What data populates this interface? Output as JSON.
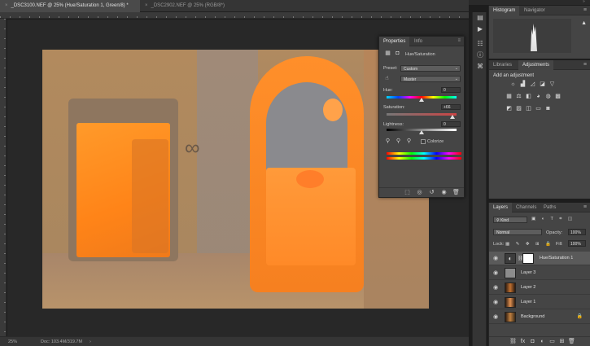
{
  "tabs": [
    {
      "label": "_DSC3100.NEF @ 25% (Hue/Saturation 1, Green/8) *",
      "active": true
    },
    {
      "label": "_DSC2902.NEF @ 25% (RGB/8*)",
      "active": false
    }
  ],
  "status": {
    "zoom": "25%",
    "doc": "Doc: 103.4M/319.7M"
  },
  "properties": {
    "tabs": [
      "Properties",
      "Info"
    ],
    "title": "Hue/Saturation",
    "preset_label": "Preset:",
    "preset_value": "Custom",
    "channel_value": "Master",
    "hue_label": "Hue:",
    "hue_value": "0",
    "saturation_label": "Saturation:",
    "saturation_value": "+66",
    "lightness_label": "Lightness:",
    "lightness_value": "0",
    "colorize_label": "Colorize"
  },
  "histogram": {
    "tabs": [
      "Histogram",
      "Navigator"
    ]
  },
  "adjustments": {
    "tabs": [
      "Libraries",
      "Adjustments"
    ],
    "title": "Add an adjustment"
  },
  "layers": {
    "tabs": [
      "Layers",
      "Channels",
      "Paths"
    ],
    "kind_label": "Kind",
    "blend_mode": "Normal",
    "opacity_label": "Opacity:",
    "opacity_value": "100%",
    "lock_label": "Lock:",
    "fill_label": "Fill:",
    "fill_value": "100%",
    "items": [
      {
        "name": "Hue/Saturation 1",
        "selected": true
      },
      {
        "name": "Layer 3",
        "selected": false
      },
      {
        "name": "Layer 2",
        "selected": false
      },
      {
        "name": "Layer 1",
        "selected": false
      },
      {
        "name": "Background",
        "selected": false
      }
    ]
  },
  "colors": {
    "photo_orange": "#ff8a1e",
    "photo_mauve": "#a48a74",
    "panel_bg": "#454545"
  },
  "icons": [
    "close-icon",
    "collapse-icon",
    "panel-menu-icon",
    "eye-icon",
    "lock-icon",
    "eyedropper-icon",
    "hand-icon",
    "warning-icon",
    "trash-icon",
    "visibility-icon",
    "reset-icon",
    "clip-icon",
    "link-icon",
    "new-layer-icon",
    "fx-icon",
    "mask-icon",
    "folder-icon",
    "adjustment-icon",
    "brightness-icon",
    "levels-icon",
    "curves-icon",
    "exposure-icon",
    "vibrance-icon",
    "hue-sat-icon",
    "color-balance-icon",
    "bw-icon",
    "photo-filter-icon",
    "channel-mixer-icon",
    "lookup-icon",
    "invert-icon",
    "posterize-icon",
    "threshold-icon",
    "gradient-map-icon",
    "selective-color-icon"
  ]
}
